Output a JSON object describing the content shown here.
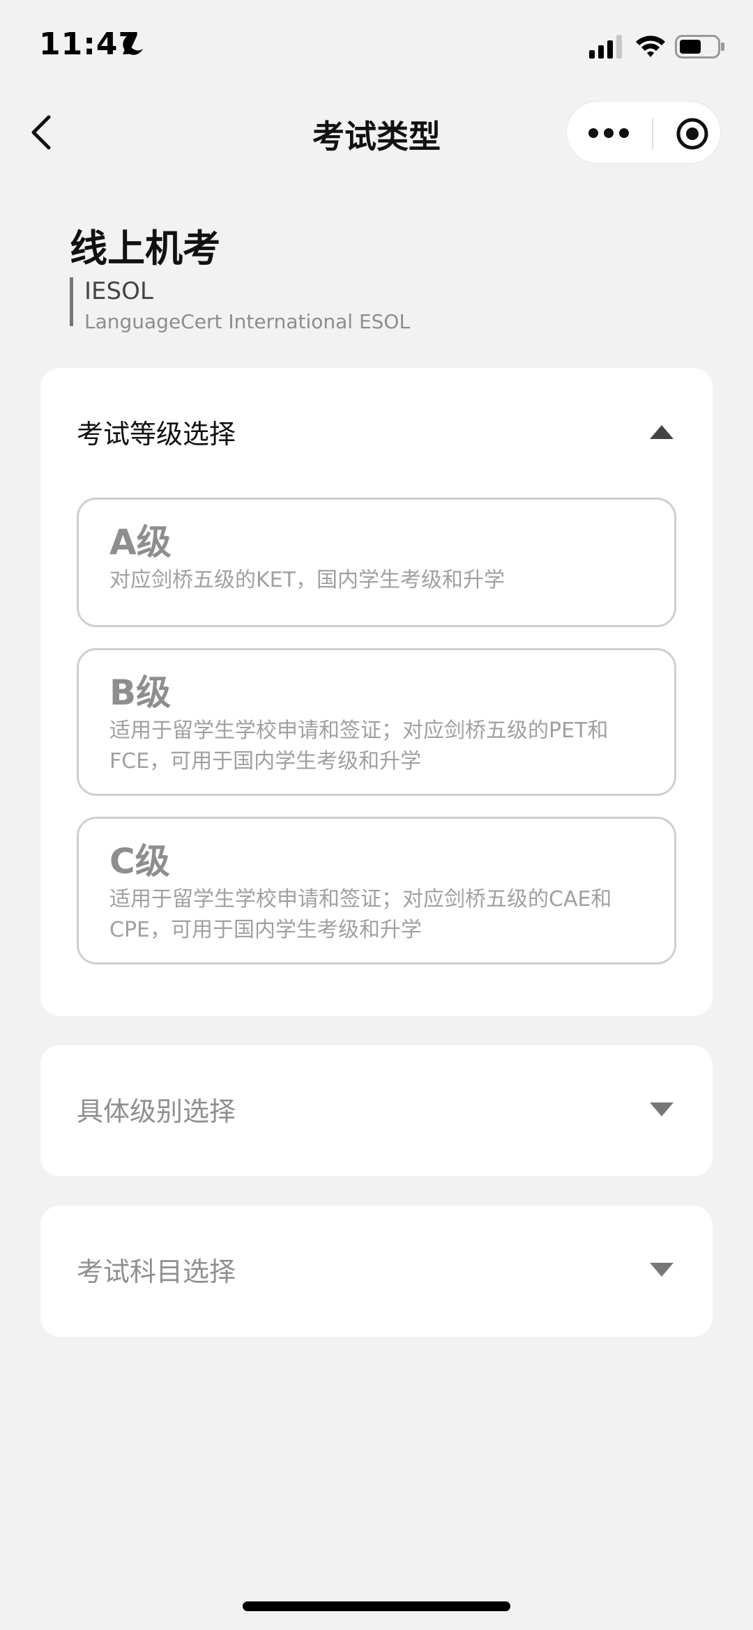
{
  "status_bar": {
    "time": "11:47",
    "icons": [
      "moon-icon",
      "signal-icon",
      "wifi-icon",
      "battery-icon"
    ]
  },
  "nav": {
    "title": "考试类型",
    "icons": [
      "back-chevron-icon",
      "more-dots-icon",
      "target-icon"
    ]
  },
  "header": {
    "title": "线上机考",
    "code": "IESOL",
    "full_name": "LanguageCert International ESOL"
  },
  "sections": {
    "level_select": {
      "title": "考试等级选择",
      "expanded": true,
      "options": [
        {
          "title": "A级",
          "desc_lines": [
            "对应剑桥五级的KET，国内学生考级和升学"
          ]
        },
        {
          "title": "B级",
          "desc_lines": [
            "适用于留学生学校申请和签证；对应剑桥五级的PET和",
            "FCE，可用于国内学生考级和升学"
          ]
        },
        {
          "title": "C级",
          "desc_lines": [
            "适用于留学生学校申请和签证；对应剑桥五级的CAE和",
            "CPE，可用于国内学生考级和升学"
          ]
        }
      ]
    },
    "specific_level": {
      "title": "具体级别选择",
      "expanded": false
    },
    "subject_select": {
      "title": "考试科目选择",
      "expanded": false
    }
  },
  "colors": {
    "background": "#f2f2f2",
    "card": "#ffffff",
    "option_border": "#cfcfcf",
    "muted_text": "#8f8f8f"
  }
}
